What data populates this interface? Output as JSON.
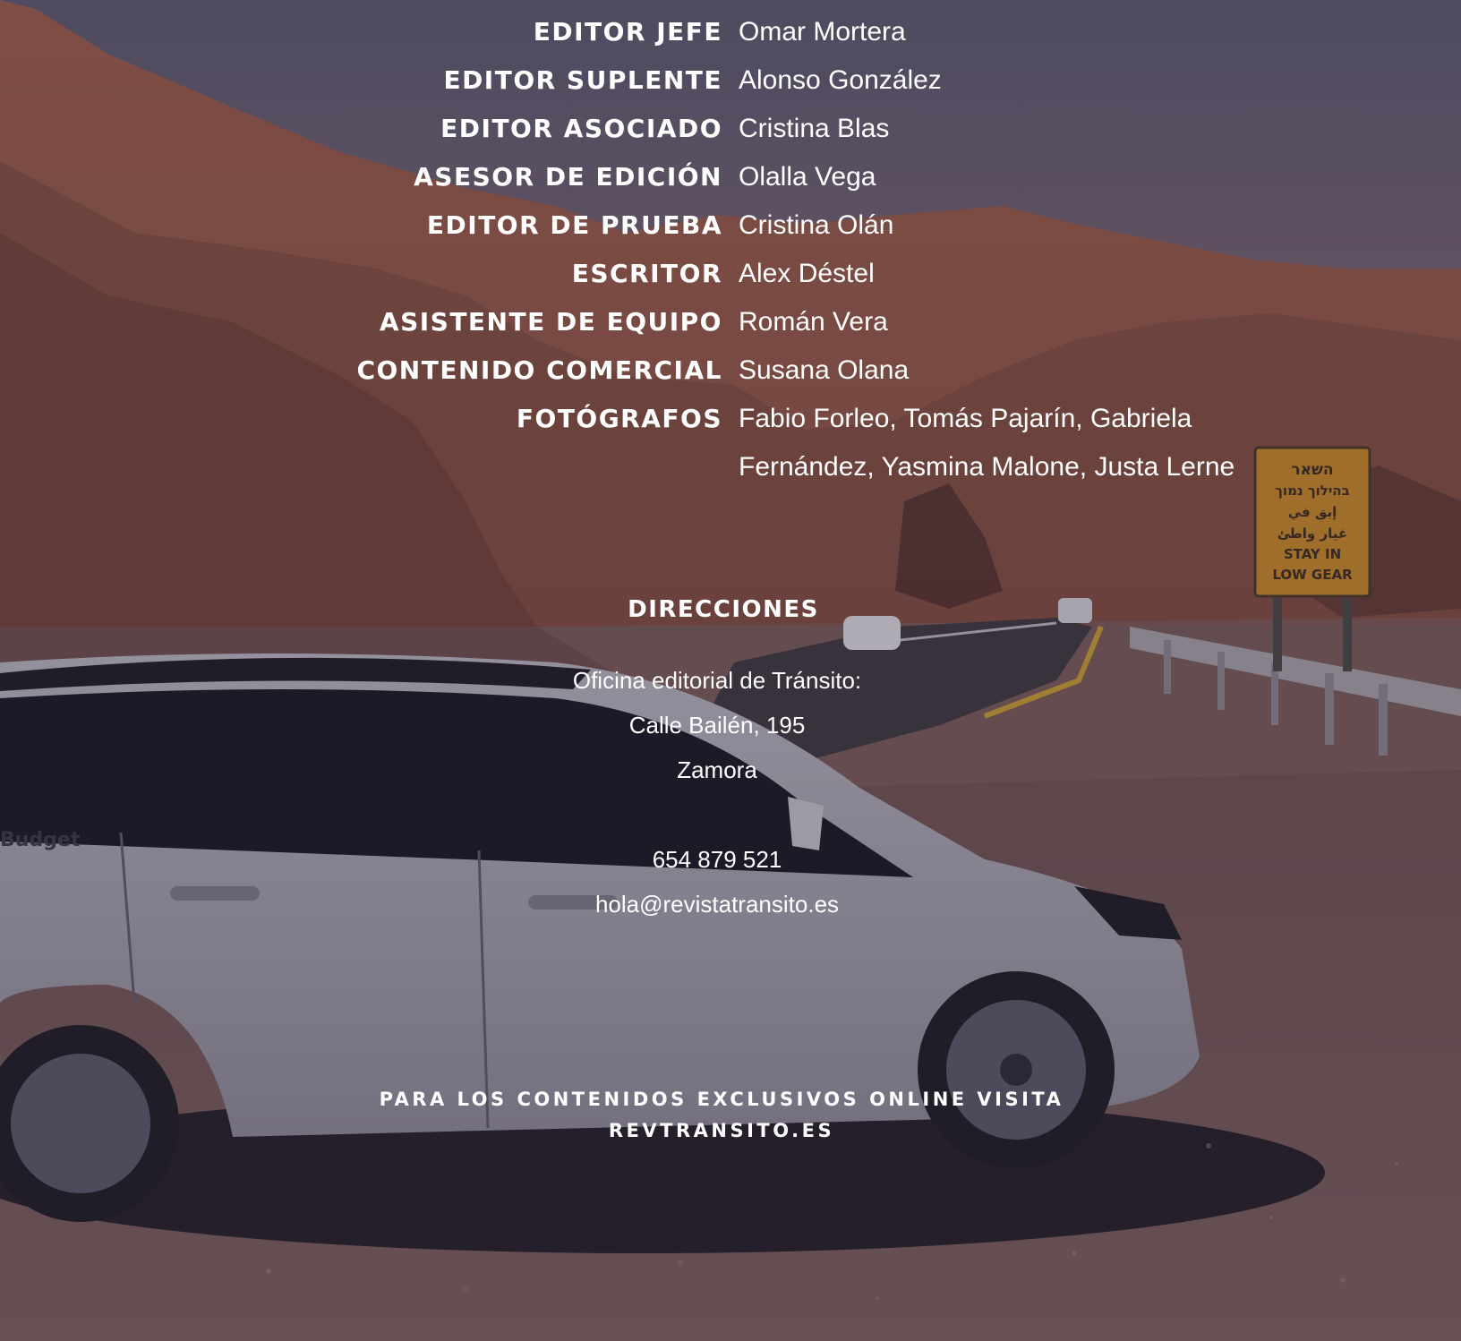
{
  "credits": [
    {
      "role": "EDITOR JEFE",
      "name": "Omar Mortera"
    },
    {
      "role": "EDITOR SUPLENTE",
      "name": "Alonso González"
    },
    {
      "role": "EDITOR ASOCIADO",
      "name": "Cristina Blas"
    },
    {
      "role": "ASESOR DE EDICIÓN",
      "name": "Olalla Vega"
    },
    {
      "role": "EDITOR DE PRUEBA",
      "name": "Cristina Olán"
    },
    {
      "role": "ESCRITOR",
      "name": "Alex Déstel"
    },
    {
      "role": "ASISTENTE DE EQUIPO",
      "name": "Román Vera"
    },
    {
      "role": "CONTENIDO COMERCIAL",
      "name": "Susana Olana"
    },
    {
      "role": "FOTÓGRAFOS",
      "name": "Fabio Forleo, Tomás Pajarín, Gabriela",
      "name_cont": "Fernández, Yasmina Malone, Justa Lerne"
    }
  ],
  "addresses": {
    "heading": "DIRECCIONES",
    "office_label": "Oficina editorial de Tránsito:",
    "street": "Calle Bailén, 195",
    "city": "Zamora",
    "phone": "654 879 521",
    "email": "hola@revistatransito.es"
  },
  "footer": {
    "line1": "PARA LOS CONTENIDOS EXCLUSIVOS ONLINE VISITA",
    "line2": "REVTRANSITO.ES"
  },
  "background": {
    "car_brand_text": "Budget",
    "sign_lines": [
      "השאר",
      "בהילוך נמוך",
      "إبق في",
      "غيار واطئ",
      "STAY IN",
      "LOW GEAR"
    ]
  },
  "colors": {
    "overlay": "#3a2330",
    "text": "#ffffff"
  }
}
